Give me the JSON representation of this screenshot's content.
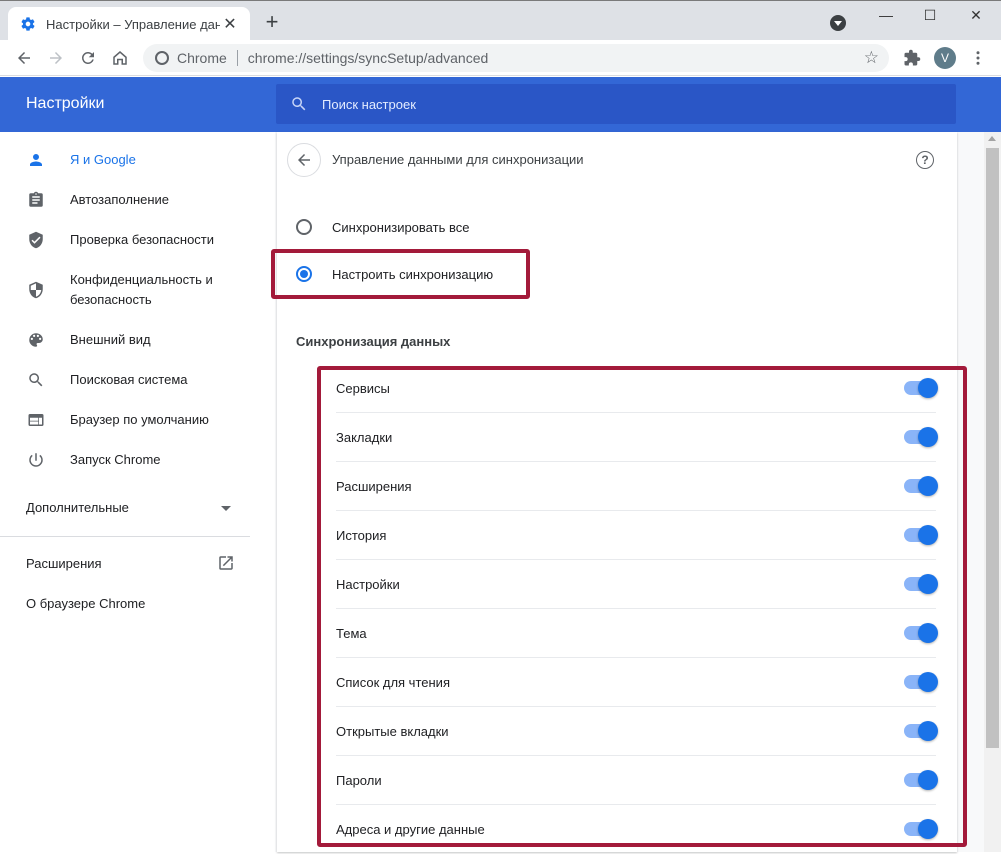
{
  "browser": {
    "tab_title": "Настройки – Управление данн",
    "omnibox_site": "Chrome",
    "omnibox_url": "chrome://settings/syncSetup/advanced",
    "profile_initial": "V"
  },
  "header": {
    "title": "Настройки",
    "search_placeholder": "Поиск настроек"
  },
  "sidebar": {
    "items": [
      {
        "label": "Я и Google",
        "icon": "person-icon"
      },
      {
        "label": "Автозаполнение",
        "icon": "clipboard-icon"
      },
      {
        "label": "Проверка безопасности",
        "icon": "shield-check-icon"
      },
      {
        "label": "Конфиденциальность и безопасность",
        "icon": "shield-half-icon"
      },
      {
        "label": "Внешний вид",
        "icon": "palette-icon"
      },
      {
        "label": "Поисковая система",
        "icon": "search-icon"
      },
      {
        "label": "Браузер по умолчанию",
        "icon": "browser-window-icon"
      },
      {
        "label": "Запуск Chrome",
        "icon": "power-icon"
      }
    ],
    "advanced_label": "Дополнительные",
    "extensions_label": "Расширения",
    "about_label": "О браузере Chrome"
  },
  "main": {
    "page_title": "Управление данными для синхронизации",
    "radio_sync_all": "Синхронизировать все",
    "radio_custom": "Настроить синхронизацию",
    "section_title": "Синхронизация данных",
    "sync_items": [
      {
        "label": "Сервисы",
        "enabled": true
      },
      {
        "label": "Закладки",
        "enabled": true
      },
      {
        "label": "Расширения",
        "enabled": true
      },
      {
        "label": "История",
        "enabled": true
      },
      {
        "label": "Настройки",
        "enabled": true
      },
      {
        "label": "Тема",
        "enabled": true
      },
      {
        "label": "Список для чтения",
        "enabled": true
      },
      {
        "label": "Открытые вкладки",
        "enabled": true
      },
      {
        "label": "Пароли",
        "enabled": true
      },
      {
        "label": "Адреса и другие данные",
        "enabled": true
      }
    ]
  },
  "colors": {
    "header_blue": "#3367d6",
    "accent_blue": "#1a73e8",
    "highlight_red": "#a31a3a"
  }
}
